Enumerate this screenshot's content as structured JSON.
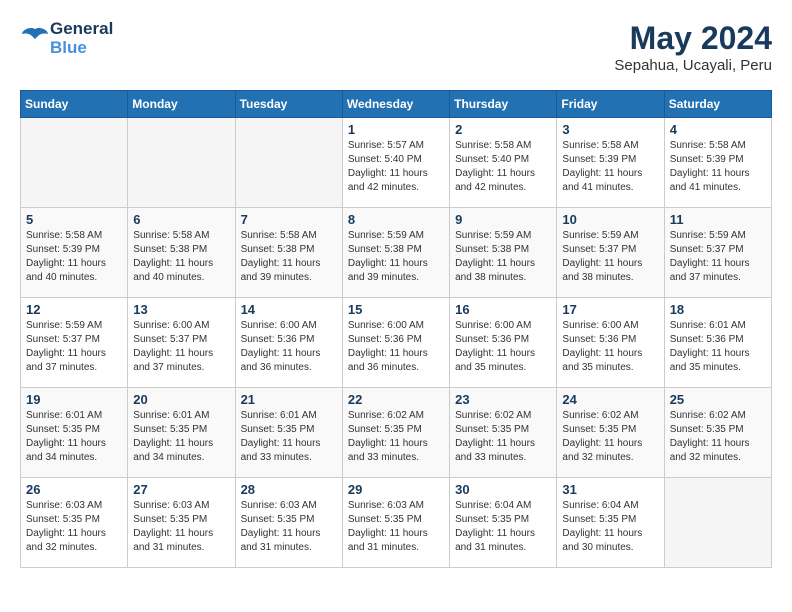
{
  "header": {
    "logo_line1": "General",
    "logo_line2": "Blue",
    "month_title": "May 2024",
    "location": "Sepahua, Ucayali, Peru"
  },
  "weekdays": [
    "Sunday",
    "Monday",
    "Tuesday",
    "Wednesday",
    "Thursday",
    "Friday",
    "Saturday"
  ],
  "weeks": [
    [
      {
        "day": "",
        "info": ""
      },
      {
        "day": "",
        "info": ""
      },
      {
        "day": "",
        "info": ""
      },
      {
        "day": "1",
        "info": "Sunrise: 5:57 AM\nSunset: 5:40 PM\nDaylight: 11 hours\nand 42 minutes."
      },
      {
        "day": "2",
        "info": "Sunrise: 5:58 AM\nSunset: 5:40 PM\nDaylight: 11 hours\nand 42 minutes."
      },
      {
        "day": "3",
        "info": "Sunrise: 5:58 AM\nSunset: 5:39 PM\nDaylight: 11 hours\nand 41 minutes."
      },
      {
        "day": "4",
        "info": "Sunrise: 5:58 AM\nSunset: 5:39 PM\nDaylight: 11 hours\nand 41 minutes."
      }
    ],
    [
      {
        "day": "5",
        "info": "Sunrise: 5:58 AM\nSunset: 5:39 PM\nDaylight: 11 hours\nand 40 minutes."
      },
      {
        "day": "6",
        "info": "Sunrise: 5:58 AM\nSunset: 5:38 PM\nDaylight: 11 hours\nand 40 minutes."
      },
      {
        "day": "7",
        "info": "Sunrise: 5:58 AM\nSunset: 5:38 PM\nDaylight: 11 hours\nand 39 minutes."
      },
      {
        "day": "8",
        "info": "Sunrise: 5:59 AM\nSunset: 5:38 PM\nDaylight: 11 hours\nand 39 minutes."
      },
      {
        "day": "9",
        "info": "Sunrise: 5:59 AM\nSunset: 5:38 PM\nDaylight: 11 hours\nand 38 minutes."
      },
      {
        "day": "10",
        "info": "Sunrise: 5:59 AM\nSunset: 5:37 PM\nDaylight: 11 hours\nand 38 minutes."
      },
      {
        "day": "11",
        "info": "Sunrise: 5:59 AM\nSunset: 5:37 PM\nDaylight: 11 hours\nand 37 minutes."
      }
    ],
    [
      {
        "day": "12",
        "info": "Sunrise: 5:59 AM\nSunset: 5:37 PM\nDaylight: 11 hours\nand 37 minutes."
      },
      {
        "day": "13",
        "info": "Sunrise: 6:00 AM\nSunset: 5:37 PM\nDaylight: 11 hours\nand 37 minutes."
      },
      {
        "day": "14",
        "info": "Sunrise: 6:00 AM\nSunset: 5:36 PM\nDaylight: 11 hours\nand 36 minutes."
      },
      {
        "day": "15",
        "info": "Sunrise: 6:00 AM\nSunset: 5:36 PM\nDaylight: 11 hours\nand 36 minutes."
      },
      {
        "day": "16",
        "info": "Sunrise: 6:00 AM\nSunset: 5:36 PM\nDaylight: 11 hours\nand 35 minutes."
      },
      {
        "day": "17",
        "info": "Sunrise: 6:00 AM\nSunset: 5:36 PM\nDaylight: 11 hours\nand 35 minutes."
      },
      {
        "day": "18",
        "info": "Sunrise: 6:01 AM\nSunset: 5:36 PM\nDaylight: 11 hours\nand 35 minutes."
      }
    ],
    [
      {
        "day": "19",
        "info": "Sunrise: 6:01 AM\nSunset: 5:35 PM\nDaylight: 11 hours\nand 34 minutes."
      },
      {
        "day": "20",
        "info": "Sunrise: 6:01 AM\nSunset: 5:35 PM\nDaylight: 11 hours\nand 34 minutes."
      },
      {
        "day": "21",
        "info": "Sunrise: 6:01 AM\nSunset: 5:35 PM\nDaylight: 11 hours\nand 33 minutes."
      },
      {
        "day": "22",
        "info": "Sunrise: 6:02 AM\nSunset: 5:35 PM\nDaylight: 11 hours\nand 33 minutes."
      },
      {
        "day": "23",
        "info": "Sunrise: 6:02 AM\nSunset: 5:35 PM\nDaylight: 11 hours\nand 33 minutes."
      },
      {
        "day": "24",
        "info": "Sunrise: 6:02 AM\nSunset: 5:35 PM\nDaylight: 11 hours\nand 32 minutes."
      },
      {
        "day": "25",
        "info": "Sunrise: 6:02 AM\nSunset: 5:35 PM\nDaylight: 11 hours\nand 32 minutes."
      }
    ],
    [
      {
        "day": "26",
        "info": "Sunrise: 6:03 AM\nSunset: 5:35 PM\nDaylight: 11 hours\nand 32 minutes."
      },
      {
        "day": "27",
        "info": "Sunrise: 6:03 AM\nSunset: 5:35 PM\nDaylight: 11 hours\nand 31 minutes."
      },
      {
        "day": "28",
        "info": "Sunrise: 6:03 AM\nSunset: 5:35 PM\nDaylight: 11 hours\nand 31 minutes."
      },
      {
        "day": "29",
        "info": "Sunrise: 6:03 AM\nSunset: 5:35 PM\nDaylight: 11 hours\nand 31 minutes."
      },
      {
        "day": "30",
        "info": "Sunrise: 6:04 AM\nSunset: 5:35 PM\nDaylight: 11 hours\nand 31 minutes."
      },
      {
        "day": "31",
        "info": "Sunrise: 6:04 AM\nSunset: 5:35 PM\nDaylight: 11 hours\nand 30 minutes."
      },
      {
        "day": "",
        "info": ""
      }
    ]
  ]
}
